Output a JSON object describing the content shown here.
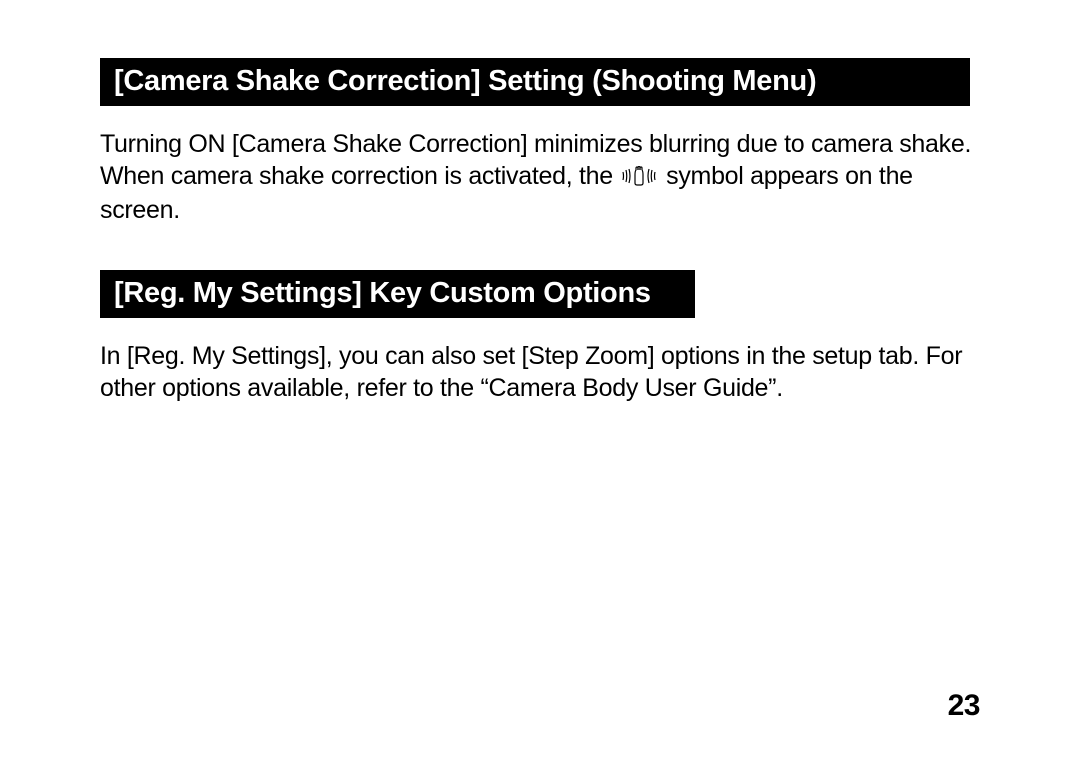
{
  "section1": {
    "heading": "[Camera Shake Correction] Setting (Shooting Menu)",
    "para1": "Turning ON [Camera Shake Correction] minimizes blurring due to camera shake.",
    "para2a": "When camera shake correction is activated, the ",
    "para2b": " symbol appears on the screen."
  },
  "section2": {
    "heading": "[Reg. My Settings] Key Custom Options",
    "para1": "In [Reg. My Settings], you can also set [Step Zoom] options in the setup tab. For other options available, refer to the “Camera Body User Guide”."
  },
  "page_number": "23"
}
